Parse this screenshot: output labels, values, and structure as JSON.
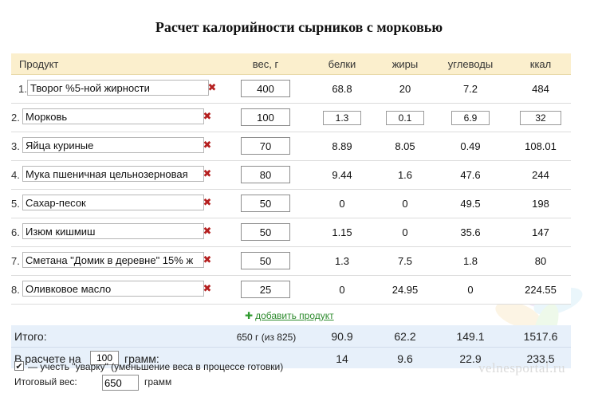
{
  "title": "Расчет калорийности сырников с морковью",
  "columns": {
    "product": "Продукт",
    "weight": "вес, г",
    "protein": "белки",
    "fat": "жиры",
    "carbs": "углеводы",
    "kcal": "ккал"
  },
  "rows": [
    {
      "idx": "1.",
      "name": "Творог %5-ной жирности",
      "weight": "400",
      "protein": "68.8",
      "fat": "20",
      "carbs": "7.2",
      "kcal": "484"
    },
    {
      "idx": "2.",
      "name": "Морковь",
      "weight": "100",
      "protein": "1.3",
      "fat": "0.1",
      "carbs": "6.9",
      "kcal": "32"
    },
    {
      "idx": "3.",
      "name": "Яйца куриные",
      "weight": "70",
      "protein": "8.89",
      "fat": "8.05",
      "carbs": "0.49",
      "kcal": "108.01"
    },
    {
      "idx": "4.",
      "name": "Мука пшеничная цельнозерновая",
      "weight": "80",
      "protein": "9.44",
      "fat": "1.6",
      "carbs": "47.6",
      "kcal": "244"
    },
    {
      "idx": "5.",
      "name": "Сахар-песок",
      "weight": "50",
      "protein": "0",
      "fat": "0",
      "carbs": "49.5",
      "kcal": "198"
    },
    {
      "idx": "6.",
      "name": "Изюм кишмиш",
      "weight": "50",
      "protein": "1.15",
      "fat": "0",
      "carbs": "35.6",
      "kcal": "147"
    },
    {
      "idx": "7.",
      "name": "Сметана \"Домик в деревне\" 15% ж",
      "weight": "50",
      "protein": "1.3",
      "fat": "7.5",
      "carbs": "1.8",
      "kcal": "80"
    },
    {
      "idx": "8.",
      "name": "Оливковое масло",
      "weight": "25",
      "protein": "0",
      "fat": "24.95",
      "carbs": "0",
      "kcal": "224.55"
    }
  ],
  "delete_icon": "✖",
  "add_product": {
    "icon": "✚",
    "label": "добавить продукт"
  },
  "totals": {
    "label": "Итого:",
    "weight": "650 г (из 825)",
    "protein": "90.9",
    "fat": "62.2",
    "carbs": "149.1",
    "kcal": "1517.6"
  },
  "per": {
    "label": "В расчете на",
    "grams": "100",
    "unit": "грамм:",
    "protein": "14",
    "fat": "9.6",
    "carbs": "22.9",
    "kcal": "233.5"
  },
  "options": {
    "evaporation_checked": true,
    "evaporation_label": "— учесть \"уварку\" (уменьшение веса в процессе готовки)",
    "final_weight_label": "Итоговый вес:",
    "final_weight_value": "650",
    "final_weight_unit": "грамм"
  },
  "watermark": "velnesportal.ru",
  "colors": {
    "header_bg": "#fbefcd",
    "totals_bg": "#e7f0fa",
    "delete": "#b52020",
    "add_link": "#2e8b2e"
  }
}
